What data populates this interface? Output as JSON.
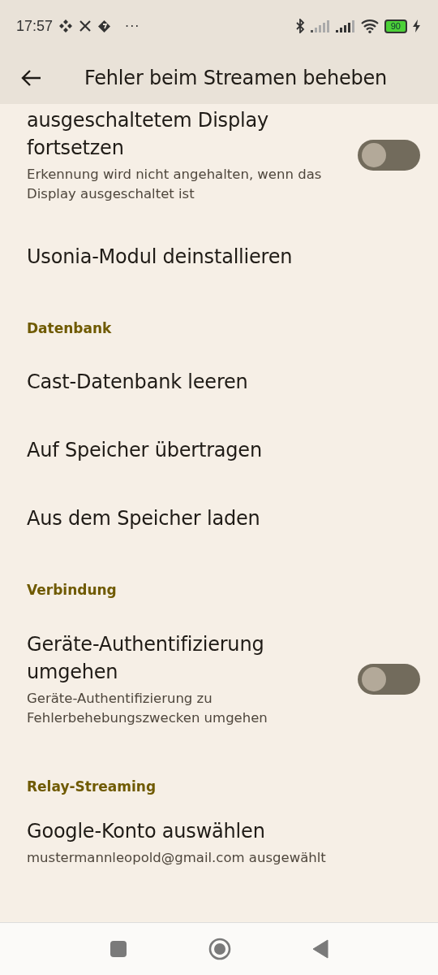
{
  "status_bar": {
    "time": "17:57",
    "more": "···",
    "battery": "90"
  },
  "app_bar": {
    "title": "Fehler beim Streamen beheben"
  },
  "items": [
    {
      "kind": "toggle",
      "title": "ausgeschaltetem Display fortsetzen",
      "subtitle": "Erkennung wird nicht angehalten, wenn das Display ausgeschaltet ist",
      "on": false
    },
    {
      "kind": "plain",
      "title": "Usonia-Modul deinstallieren"
    },
    {
      "kind": "header",
      "title": "Datenbank"
    },
    {
      "kind": "plain",
      "title": "Cast-Datenbank leeren"
    },
    {
      "kind": "plain",
      "title": "Auf Speicher übertragen"
    },
    {
      "kind": "plain",
      "title": "Aus dem Speicher laden"
    },
    {
      "kind": "header",
      "title": "Verbindung"
    },
    {
      "kind": "toggle",
      "title": "Geräte-Authentifizierung umgehen",
      "subtitle": "Geräte-Authentifizierung zu Fehlerbehebungszwecken umgehen",
      "on": false
    },
    {
      "kind": "header",
      "title": "Relay-Streaming"
    },
    {
      "kind": "plain",
      "title": "Google-Konto auswählen",
      "subtitle": "mustermannleopold@gmail.com ausgewählt"
    }
  ]
}
